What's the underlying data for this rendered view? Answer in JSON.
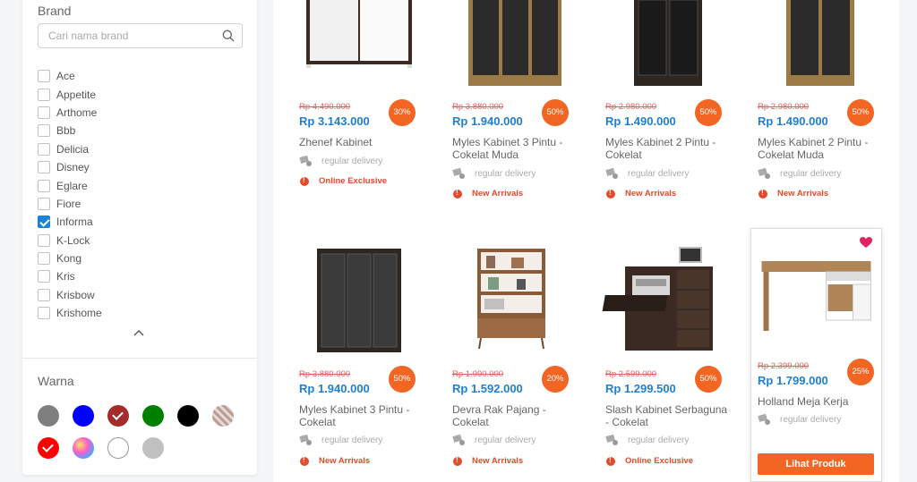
{
  "filters": {
    "brand": {
      "title": "Brand",
      "search_placeholder": "Cari nama brand",
      "items": [
        {
          "label": "Ace",
          "checked": false
        },
        {
          "label": "Appetite",
          "checked": false
        },
        {
          "label": "Arthome",
          "checked": false
        },
        {
          "label": "Bbb",
          "checked": false
        },
        {
          "label": "Delicia",
          "checked": false
        },
        {
          "label": "Disney",
          "checked": false
        },
        {
          "label": "Eglare",
          "checked": false
        },
        {
          "label": "Fiore",
          "checked": false
        },
        {
          "label": "Informa",
          "checked": true
        },
        {
          "label": "K-Lock",
          "checked": false
        },
        {
          "label": "Kong",
          "checked": false
        },
        {
          "label": "Kris",
          "checked": false
        },
        {
          "label": "Krisbow",
          "checked": false
        },
        {
          "label": "Krishome",
          "checked": false
        }
      ]
    },
    "warna": {
      "title": "Warna",
      "swatches": [
        {
          "color": "#7f7f7f",
          "checked": false
        },
        {
          "color": "#0000ff",
          "checked": false
        },
        {
          "color": "#a52a2a",
          "checked": true
        },
        {
          "color": "#008000",
          "checked": false
        },
        {
          "color": "#000000",
          "checked": false
        },
        {
          "color": "pattern-plaid",
          "checked": false
        },
        {
          "color": "#ff0000",
          "checked": true
        },
        {
          "color": "gradient-multicolor",
          "checked": false
        },
        {
          "color": "#ffffff",
          "checked": false
        },
        {
          "color": "#c0c0c0",
          "checked": false
        }
      ]
    }
  },
  "products": [
    {
      "name": "Zhenef Kabinet",
      "original_price": "Rp 4.490.000",
      "price": "Rp 3.143.000",
      "discount": "30%",
      "delivery": "regular delivery",
      "tag": "Online Exclusive"
    },
    {
      "name": "Myles Kabinet 3 Pintu - Cokelat Muda",
      "original_price": "Rp 3.880.000",
      "price": "Rp 1.940.000",
      "discount": "50%",
      "delivery": "regular delivery",
      "tag": "New Arrivals"
    },
    {
      "name": "Myles Kabinet 2 Pintu - Cokelat",
      "original_price": "Rp 2.980.000",
      "price": "Rp 1.490.000",
      "discount": "50%",
      "delivery": "regular delivery",
      "tag": "New Arrivals"
    },
    {
      "name": "Myles Kabinet 2 Pintu - Cokelat Muda",
      "original_price": "Rp 2.980.000",
      "price": "Rp 1.490.000",
      "discount": "50%",
      "delivery": "regular delivery",
      "tag": "New Arrivals"
    },
    {
      "name": "Myles Kabinet 3 Pintu - Cokelat",
      "original_price": "Rp 3.880.000",
      "price": "Rp 1.940.000",
      "discount": "50%",
      "delivery": "regular delivery",
      "tag": "New Arrivals"
    },
    {
      "name": "Devra Rak Pajang - Cokelat",
      "original_price": "Rp 1.990.000",
      "price": "Rp 1.592.000",
      "discount": "20%",
      "delivery": "regular delivery",
      "tag": "New Arrivals"
    },
    {
      "name": "Slash Kabinet Serbaguna - Cokelat",
      "original_price": "Rp 2.599.000",
      "price": "Rp 1.299.500",
      "discount": "50%",
      "delivery": "regular delivery",
      "tag": "Online Exclusive"
    },
    {
      "name": "Holland Meja Kerja",
      "original_price": "Rp 2.399.000",
      "price": "Rp 1.799.000",
      "discount": "25%",
      "delivery": "regular delivery",
      "tag": "",
      "cta": "Lihat Produk",
      "favorited": true
    }
  ],
  "colors": {
    "accent": "#f26522",
    "price": "#1f7fd0",
    "tag": "#e24c2c",
    "checkbox": "#1a82d8"
  }
}
